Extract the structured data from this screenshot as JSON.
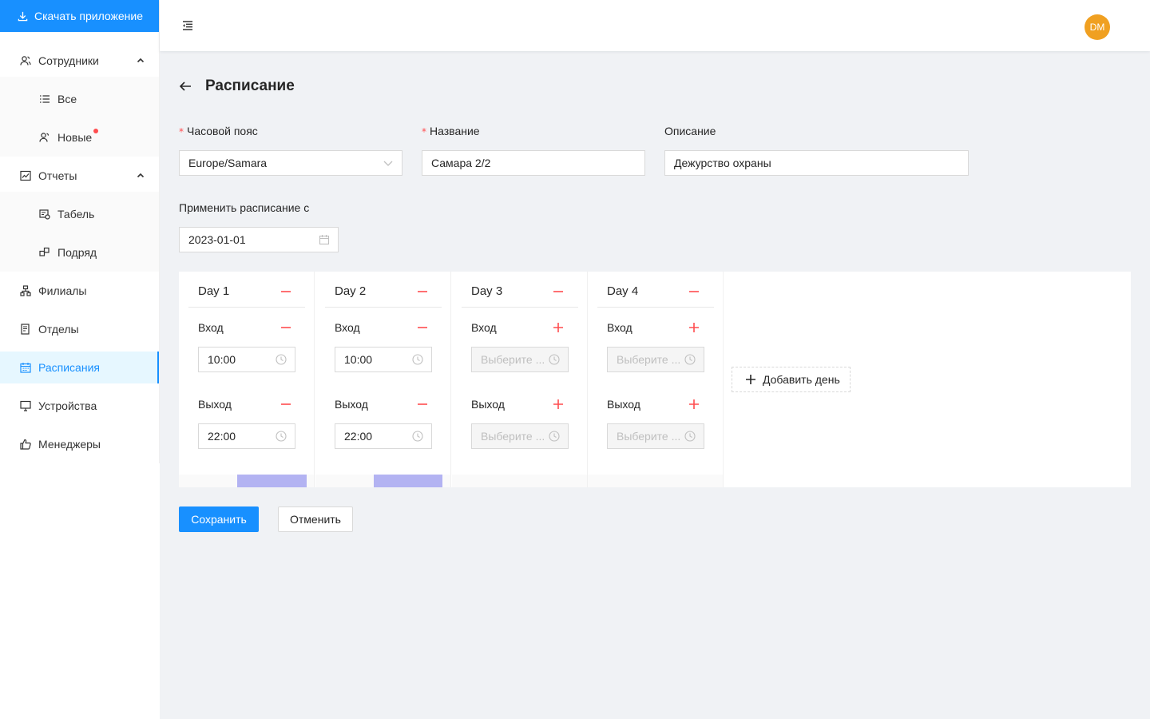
{
  "sidebar": {
    "download_label": "Скачать приложение",
    "items": {
      "employees": "Сотрудники",
      "all": "Все",
      "new": "Новые",
      "reports": "Отчеты",
      "timesheet": "Табель",
      "contract": "Подряд",
      "branches": "Филиалы",
      "departments": "Отделы",
      "schedules": "Расписания",
      "devices": "Устройства",
      "managers": "Менеджеры"
    }
  },
  "header": {
    "avatar_initials": "DM"
  },
  "page": {
    "title": "Расписание"
  },
  "form": {
    "timezone_label": "Часовой пояс",
    "timezone_value": "Europe/Samara",
    "name_label": "Название",
    "name_value": "Самара 2/2",
    "description_label": "Описание",
    "description_value": "Дежурство охраны",
    "apply_from_label": "Применить расписание с",
    "apply_from_value": "2023-01-01",
    "required_mark": "*"
  },
  "schedule": {
    "entry_label": "Вход",
    "exit_label": "Выход",
    "placeholder": "Выберите ...",
    "days": [
      {
        "title": "Day 1",
        "entry": "10:00",
        "exit": "22:00"
      },
      {
        "title": "Day 2",
        "entry": "10:00",
        "exit": "22:00"
      },
      {
        "title": "Day 3",
        "entry": "",
        "exit": ""
      },
      {
        "title": "Day 4",
        "entry": "",
        "exit": ""
      }
    ],
    "add_day_label": "Добавить день"
  },
  "actions": {
    "save_label": "Сохранить",
    "cancel_label": "Отменить"
  },
  "colors": {
    "primary": "#1890ff",
    "danger": "#ff4d4f",
    "avatar": "#f0a021"
  }
}
